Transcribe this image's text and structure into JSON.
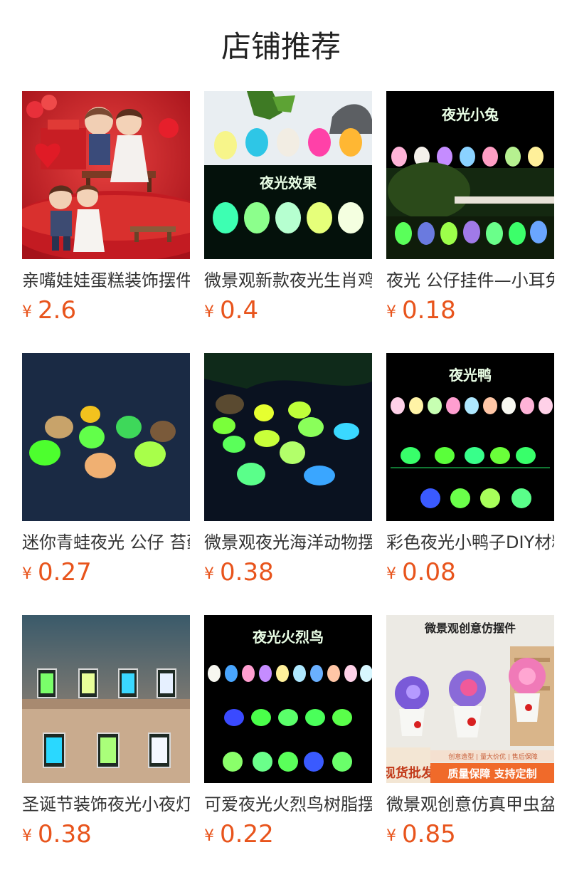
{
  "section_title": "店铺推荐",
  "currency_symbol": "¥",
  "colors": {
    "price": "#e8541c",
    "glow_green": "#7dff7d"
  },
  "products": [
    {
      "name": "亲嘴娃娃蛋糕装饰摆件",
      "price": "2.6",
      "image_caption": "",
      "image_theme": "wedding-couple-figurines"
    },
    {
      "name": "微景观新款夜光生肖鸡",
      "price": "0.4",
      "image_caption": "夜光效果",
      "image_theme": "glow-chicks"
    },
    {
      "name": "夜光 公仔挂件—小耳兔",
      "price": "0.18",
      "image_caption": "夜光小兔",
      "image_theme": "glow-rabbits"
    },
    {
      "name": "迷你青蛙夜光 公仔 苔藓",
      "price": "0.27",
      "image_caption": "",
      "image_theme": "glow-frogs"
    },
    {
      "name": "微景观夜光海洋动物摆件",
      "price": "0.38",
      "image_caption": "",
      "image_theme": "glow-sea-animals"
    },
    {
      "name": "彩色夜光小鸭子DIY材料",
      "price": "0.08",
      "image_caption": "夜光鸭",
      "image_theme": "glow-ducks"
    },
    {
      "name": "圣诞节装饰夜光小夜灯",
      "price": "0.38",
      "image_caption": "",
      "image_theme": "glow-lanterns"
    },
    {
      "name": "可爱夜光火烈鸟树脂摆件",
      "price": "0.22",
      "image_caption": "夜光火烈鸟",
      "image_theme": "glow-flamingo-birds"
    },
    {
      "name": "微景观创意仿真甲虫盆栽",
      "price": "0.85",
      "image_caption": "微景观创意仿摆件",
      "image_theme": "potted-flowers-ladybug",
      "image_badges": {
        "left": "现货批发",
        "right": "质量保障 支持定制",
        "strip": "创意造型 | 量大价优 | 售后保障"
      }
    }
  ]
}
